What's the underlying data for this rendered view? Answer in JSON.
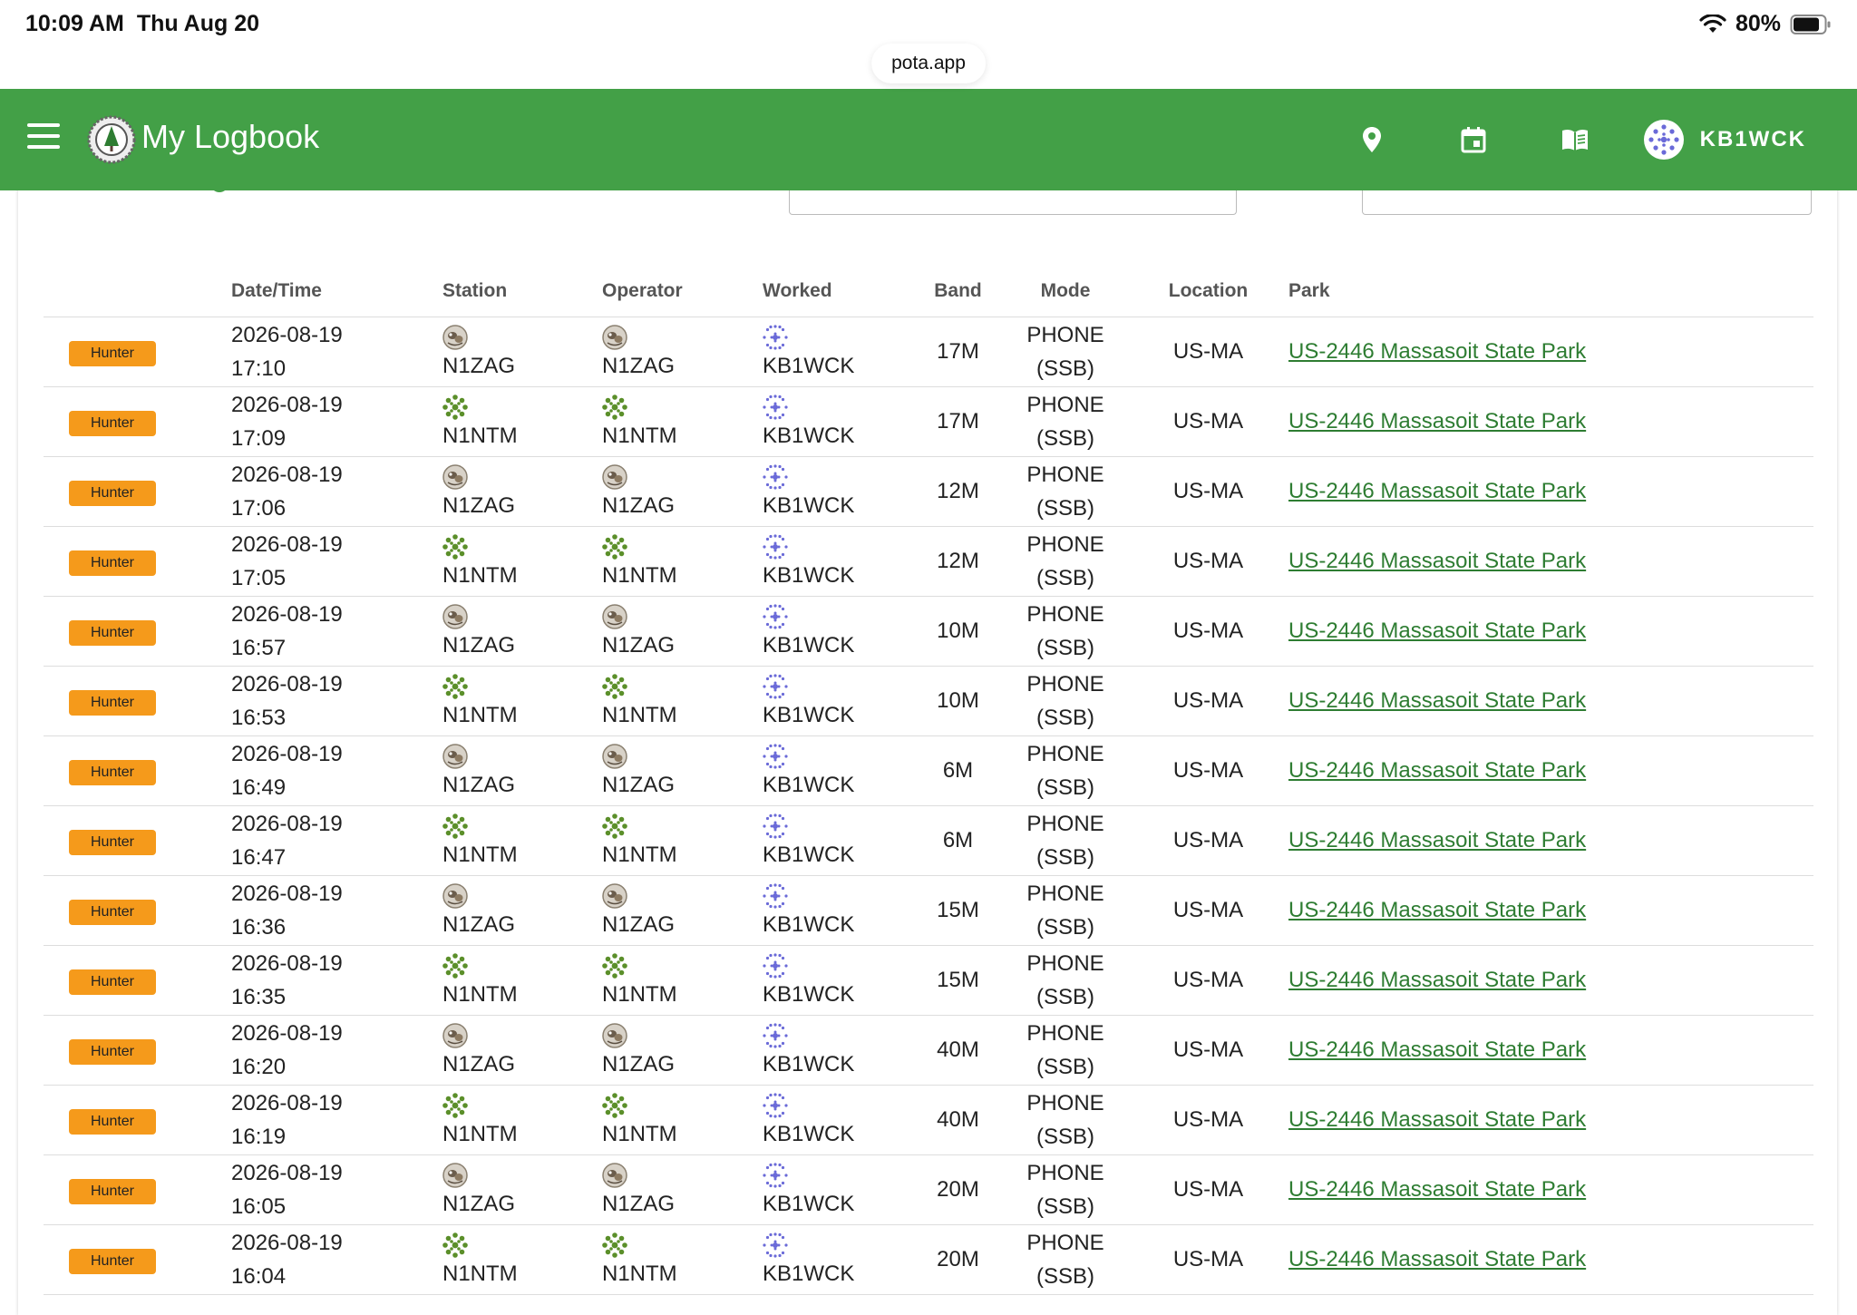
{
  "status_bar": {
    "time": "10:09 AM",
    "date": "Thu Aug 20",
    "battery": "80%"
  },
  "browser": {
    "url": "pota.app"
  },
  "appbar": {
    "title": "My Logbook",
    "user": "KB1WCK",
    "icons": [
      "menu-icon",
      "location-pin-icon",
      "calendar-icon",
      "book-icon"
    ],
    "color": "#43a047"
  },
  "table": {
    "headers": [
      "",
      "Date/Time",
      "Station",
      "Operator",
      "Worked",
      "Band",
      "Mode",
      "Location",
      "Park"
    ],
    "rows": [
      {
        "badge": "Hunter",
        "date": "2026-08-19",
        "time": "17:10",
        "station": "N1ZAG",
        "operator": "N1ZAG",
        "worked": "KB1WCK",
        "band": "17M",
        "mode1": "PHONE",
        "mode2": "(SSB)",
        "location": "US-MA",
        "park": "US-2446 Massasoit State Park"
      },
      {
        "badge": "Hunter",
        "date": "2026-08-19",
        "time": "17:09",
        "station": "N1NTM",
        "operator": "N1NTM",
        "worked": "KB1WCK",
        "band": "17M",
        "mode1": "PHONE",
        "mode2": "(SSB)",
        "location": "US-MA",
        "park": "US-2446 Massasoit State Park"
      },
      {
        "badge": "Hunter",
        "date": "2026-08-19",
        "time": "17:06",
        "station": "N1ZAG",
        "operator": "N1ZAG",
        "worked": "KB1WCK",
        "band": "12M",
        "mode1": "PHONE",
        "mode2": "(SSB)",
        "location": "US-MA",
        "park": "US-2446 Massasoit State Park"
      },
      {
        "badge": "Hunter",
        "date": "2026-08-19",
        "time": "17:05",
        "station": "N1NTM",
        "operator": "N1NTM",
        "worked": "KB1WCK",
        "band": "12M",
        "mode1": "PHONE",
        "mode2": "(SSB)",
        "location": "US-MA",
        "park": "US-2446 Massasoit State Park"
      },
      {
        "badge": "Hunter",
        "date": "2026-08-19",
        "time": "16:57",
        "station": "N1ZAG",
        "operator": "N1ZAG",
        "worked": "KB1WCK",
        "band": "10M",
        "mode1": "PHONE",
        "mode2": "(SSB)",
        "location": "US-MA",
        "park": "US-2446 Massasoit State Park"
      },
      {
        "badge": "Hunter",
        "date": "2026-08-19",
        "time": "16:53",
        "station": "N1NTM",
        "operator": "N1NTM",
        "worked": "KB1WCK",
        "band": "10M",
        "mode1": "PHONE",
        "mode2": "(SSB)",
        "location": "US-MA",
        "park": "US-2446 Massasoit State Park"
      },
      {
        "badge": "Hunter",
        "date": "2026-08-19",
        "time": "16:49",
        "station": "N1ZAG",
        "operator": "N1ZAG",
        "worked": "KB1WCK",
        "band": "6M",
        "mode1": "PHONE",
        "mode2": "(SSB)",
        "location": "US-MA",
        "park": "US-2446 Massasoit State Park"
      },
      {
        "badge": "Hunter",
        "date": "2026-08-19",
        "time": "16:47",
        "station": "N1NTM",
        "operator": "N1NTM",
        "worked": "KB1WCK",
        "band": "6M",
        "mode1": "PHONE",
        "mode2": "(SSB)",
        "location": "US-MA",
        "park": "US-2446 Massasoit State Park"
      },
      {
        "badge": "Hunter",
        "date": "2026-08-19",
        "time": "16:36",
        "station": "N1ZAG",
        "operator": "N1ZAG",
        "worked": "KB1WCK",
        "band": "15M",
        "mode1": "PHONE",
        "mode2": "(SSB)",
        "location": "US-MA",
        "park": "US-2446 Massasoit State Park"
      },
      {
        "badge": "Hunter",
        "date": "2026-08-19",
        "time": "16:35",
        "station": "N1NTM",
        "operator": "N1NTM",
        "worked": "KB1WCK",
        "band": "15M",
        "mode1": "PHONE",
        "mode2": "(SSB)",
        "location": "US-MA",
        "park": "US-2446 Massasoit State Park"
      },
      {
        "badge": "Hunter",
        "date": "2026-08-19",
        "time": "16:20",
        "station": "N1ZAG",
        "operator": "N1ZAG",
        "worked": "KB1WCK",
        "band": "40M",
        "mode1": "PHONE",
        "mode2": "(SSB)",
        "location": "US-MA",
        "park": "US-2446 Massasoit State Park"
      },
      {
        "badge": "Hunter",
        "date": "2026-08-19",
        "time": "16:19",
        "station": "N1NTM",
        "operator": "N1NTM",
        "worked": "KB1WCK",
        "band": "40M",
        "mode1": "PHONE",
        "mode2": "(SSB)",
        "location": "US-MA",
        "park": "US-2446 Massasoit State Park"
      },
      {
        "badge": "Hunter",
        "date": "2026-08-19",
        "time": "16:05",
        "station": "N1ZAG",
        "operator": "N1ZAG",
        "worked": "KB1WCK",
        "band": "20M",
        "mode1": "PHONE",
        "mode2": "(SSB)",
        "location": "US-MA",
        "park": "US-2446 Massasoit State Park"
      },
      {
        "badge": "Hunter",
        "date": "2026-08-19",
        "time": "16:04",
        "station": "N1NTM",
        "operator": "N1NTM",
        "worked": "KB1WCK",
        "band": "20M",
        "mode1": "PHONE",
        "mode2": "(SSB)",
        "location": "US-MA",
        "park": "US-2446 Massasoit State Park"
      }
    ]
  }
}
